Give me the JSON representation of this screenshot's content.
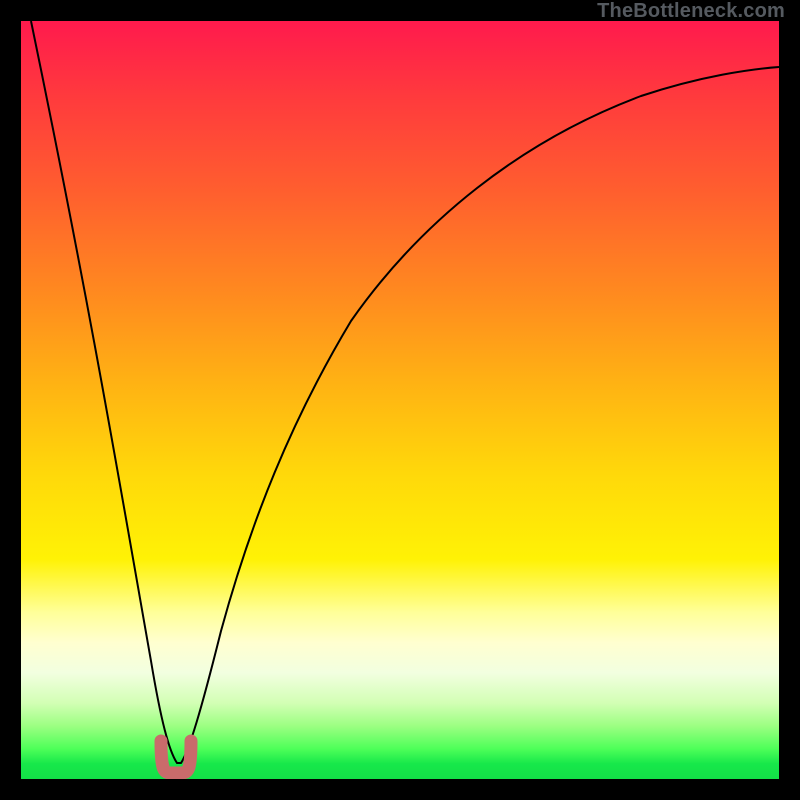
{
  "watermark": "TheBottleneck.com",
  "colors": {
    "background": "#000000",
    "curve_stroke": "#000000",
    "marker_fill": "#c96b6b",
    "marker_stroke": "#c96b6b"
  },
  "chart_data": {
    "type": "line",
    "title": "",
    "xlabel": "",
    "ylabel": "",
    "xlim": [
      0,
      100
    ],
    "ylim": [
      0,
      100
    ],
    "series": [
      {
        "name": "bottleneck-curve",
        "x": [
          0,
          4,
          8,
          12,
          16,
          20,
          24,
          28,
          32,
          36,
          40,
          44,
          48,
          52,
          56,
          60,
          64,
          68,
          72,
          76,
          80,
          84,
          88,
          92,
          96,
          100
        ],
        "values": [
          100,
          80,
          58,
          36,
          14,
          0,
          0,
          11,
          24,
          36,
          46,
          54,
          61,
          67,
          72,
          76,
          79,
          82,
          84.5,
          86.5,
          88,
          89.5,
          90.7,
          91.7,
          92.6,
          93.3
        ]
      }
    ],
    "markers": [
      {
        "shape": "U",
        "x": 20,
        "y": 0
      }
    ],
    "gradient_zones": [
      {
        "color": "#ff1a4d",
        "position": 0
      },
      {
        "color": "#ffd90a",
        "position": 60
      },
      {
        "color": "#ffff99",
        "position": 78
      },
      {
        "color": "#13df47",
        "position": 100
      }
    ]
  }
}
